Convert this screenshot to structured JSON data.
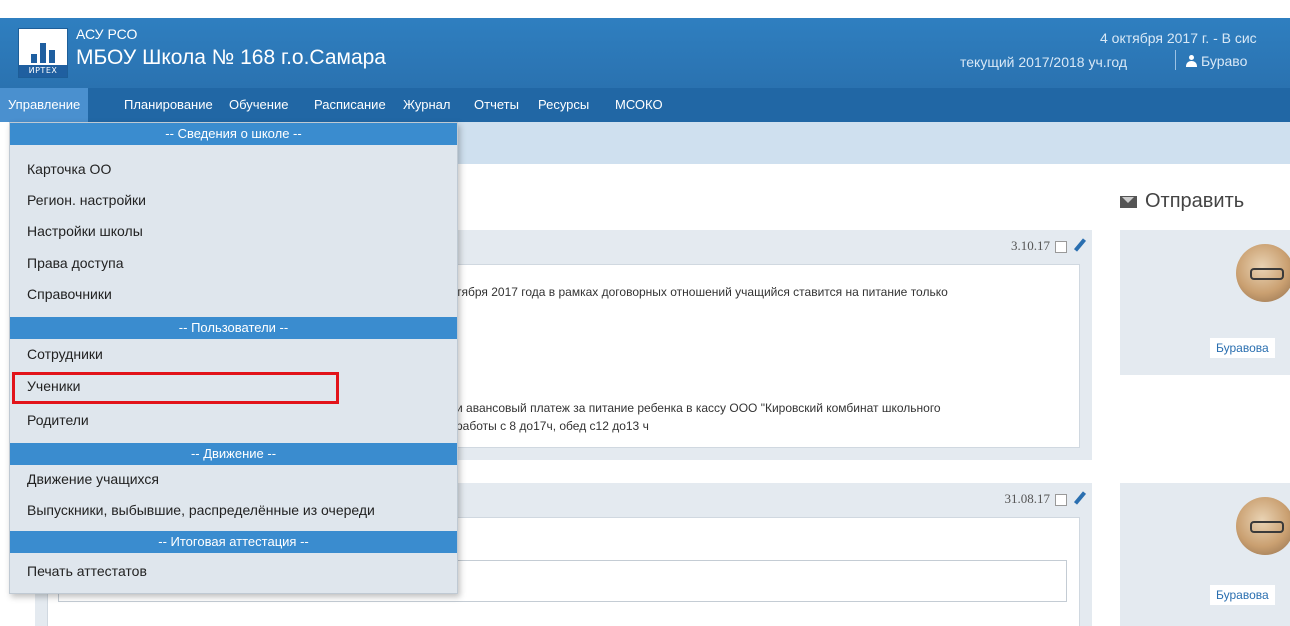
{
  "header": {
    "app_name": "АСУ РСО",
    "school_name": "МБОУ Школа № 168 г.о.Самара",
    "logo_text": "ИРТЕХ",
    "date_text": "4 октября 2017 г. - В сис",
    "year_text": "текущий 2017/2018 уч.год",
    "user_name": "Бураво"
  },
  "nav": {
    "items": [
      "Управление",
      "Планирование",
      "Обучение",
      "Расписание",
      "Журнал",
      "Отчеты",
      "Ресурсы",
      "МСОКО"
    ]
  },
  "dropdown": {
    "sections": [
      {
        "label": "-- Сведения о школе --",
        "items": [
          "Карточка ОО",
          "Регион. настройки",
          "Настройки школы",
          "Права доступа",
          "Справочники"
        ]
      },
      {
        "label": "-- Пользователи --",
        "items": [
          "Сотрудники",
          "Ученики",
          "Родители"
        ]
      },
      {
        "label": "-- Движение --",
        "items": [
          "Движение учащихся",
          "Выпускники, выбывшие, распределённые из очереди"
        ]
      },
      {
        "label": "-- Итоговая аттестация --",
        "items": [
          "Печать аттестатов"
        ]
      }
    ],
    "highlight_color": "#e2131a"
  },
  "main": {
    "send_label": "Отправить",
    "posts": [
      {
        "date": "3.10.17",
        "line1": "тября 2017 года в рамках договорных отношений учащийся ставится на питание только",
        "line2": "и авансовый платеж за питание ребенка в кассу ООО \"Кировский комбинат школьного",
        "line3": "работы с 8 до17ч, обед с12 до13 ч"
      },
      {
        "date": "31.08.17"
      }
    ],
    "side_author": "Буравова"
  },
  "colors": {
    "header": "#2f7fc0",
    "nav": "#2167a5",
    "section": "#3a8ccf"
  }
}
